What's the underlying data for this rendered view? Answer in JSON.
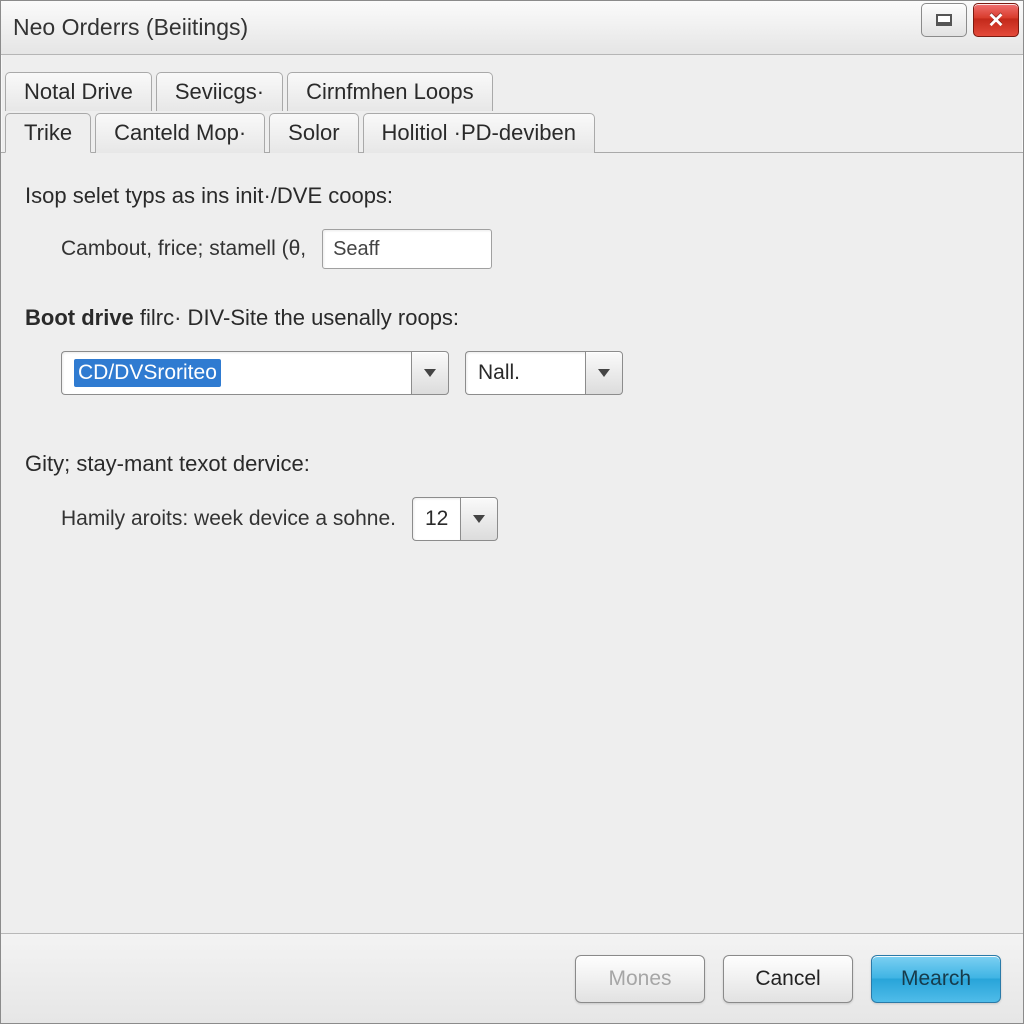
{
  "window": {
    "title": "Neo Orderrs (Beiitings)"
  },
  "tabs_row1": [
    {
      "label": "Notal Drive"
    },
    {
      "label": "Seviicgs·"
    },
    {
      "label": "Cirnfmhen Loops"
    }
  ],
  "tabs_row2": [
    {
      "label": "Trike",
      "active": true
    },
    {
      "label": "Canteld Mop·"
    },
    {
      "label": "Solor"
    },
    {
      "label": "Holitiol ·PD-deviben"
    }
  ],
  "section1": {
    "label": "Isop selet typs as ins init·/DVE coops:",
    "field_label": "Cambout, frice; stamell (θ,",
    "input_value": "Seaff"
  },
  "section2": {
    "lead": "Boot drive",
    "rest": " filrc· DIV-Site the usenally roops:",
    "combo_primary": "CD/DVSroriteo",
    "combo_secondary": "Nall."
  },
  "section3": {
    "label": "Gity; stay-mant texot dervice:",
    "field_label": "Hamily aroits: week device a sohne.",
    "combo_value": "12"
  },
  "buttons": {
    "mones": "Mones",
    "cancel": "Cancel",
    "mearch": "Mearch"
  }
}
